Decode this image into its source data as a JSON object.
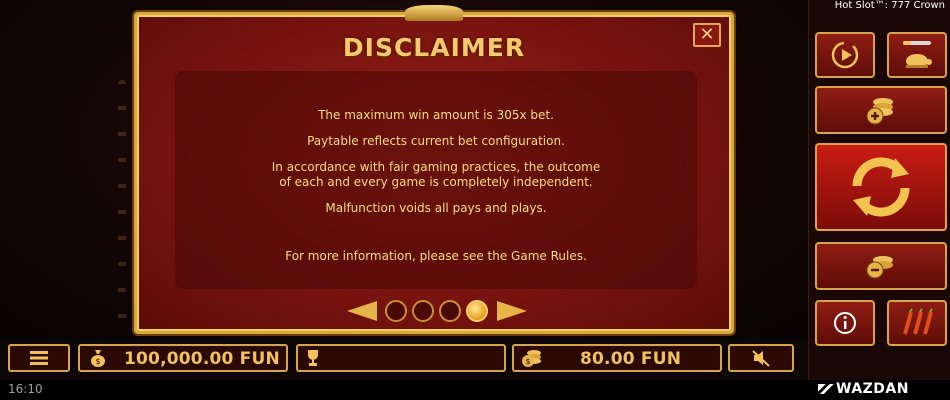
{
  "modal": {
    "title": "DISCLAIMER",
    "close_label": "✕",
    "lines": [
      "The maximum win amount is 305x bet.",
      "Paytable reflects current bet configuration.",
      "In accordance with fair gaming practices, the outcome",
      "of each and every game is completely independent.",
      "Malfunction voids all pays and plays.",
      "For more information, please see the Game Rules."
    ],
    "pager": {
      "pages": 4,
      "current": 4
    }
  },
  "side_panel": {
    "game_name": "Hot Slot™: 777 Crown",
    "buttons": [
      "autoplay-icon",
      "turbo-icon",
      "coins-plus-icon",
      "spin-icon",
      "coins-minus-icon",
      "info-icon",
      "chili-icon"
    ]
  },
  "bottom_bar": {
    "balance": "100,000.00 FUN",
    "bet": "80.00 FUN",
    "win": ""
  },
  "status_bar": {
    "time": "16:10",
    "brand": "WAZDAN"
  },
  "colors": {
    "gold": "#f2c15a",
    "modal_red": "#9a1f1a",
    "border_gold": "#d9a93c"
  }
}
